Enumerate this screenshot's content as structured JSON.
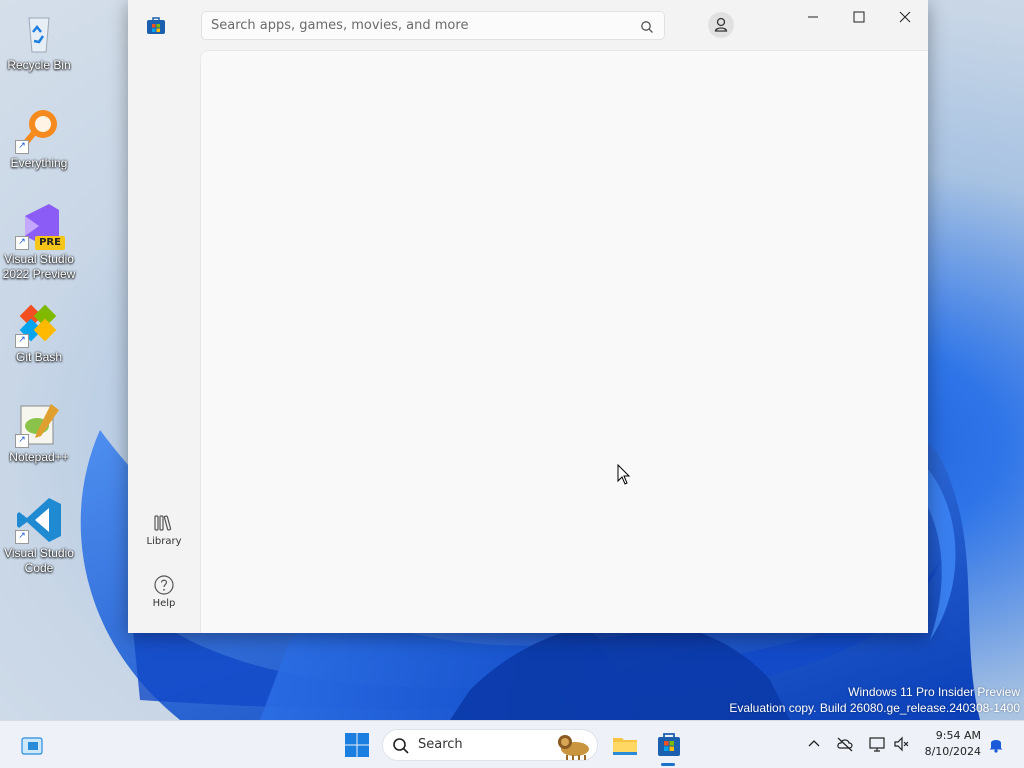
{
  "desktop": {
    "icons": [
      {
        "label": "Recycle Bin",
        "icon": "recycle-bin-icon"
      },
      {
        "label": "Everything",
        "icon": "everything-search-icon"
      },
      {
        "label": "Visual Studio 2022 Preview",
        "icon": "visual-studio-preview-icon",
        "badge": "PRE"
      },
      {
        "label": "Git Bash",
        "icon": "git-bash-icon"
      },
      {
        "label": "Notepad++",
        "icon": "notepad-plus-plus-icon"
      },
      {
        "label": "Visual Studio Code",
        "icon": "vscode-icon"
      }
    ],
    "watermark": {
      "line1": "Windows 11 Pro Insider Preview",
      "line2": "Evaluation copy. Build 26080.ge_release.240308-1400"
    }
  },
  "store_window": {
    "search": {
      "placeholder": "Search apps, games, movies, and more",
      "value": ""
    },
    "nav": [
      {
        "label": "Library",
        "icon": "library-icon"
      },
      {
        "label": "Help",
        "icon": "help-icon"
      }
    ],
    "colors": {
      "background": "#f3f3f3",
      "content": "#f9f9f9",
      "accent": "#0067c0"
    }
  },
  "taskbar": {
    "search_label": "Search",
    "clock": {
      "time": "9:54 AM",
      "date": "8/10/2024"
    },
    "pinned": [
      "widgets-icon",
      "start-icon",
      "file-explorer-icon",
      "microsoft-store-icon"
    ],
    "tray": [
      "chevron-up-icon",
      "onedrive-offline-icon",
      "network-icon",
      "volume-muted-icon",
      "notification-bell-icon"
    ]
  }
}
